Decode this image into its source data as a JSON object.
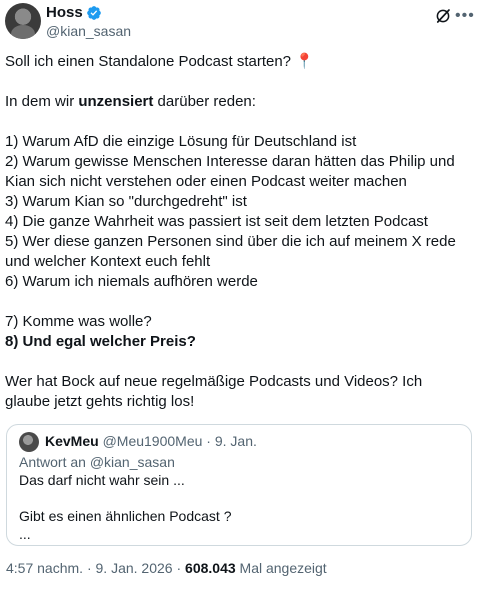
{
  "author": {
    "name": "Hoss",
    "handle": "@kian_sasan"
  },
  "tweet": {
    "line1": "Soll ich einen Standalone Podcast starten? 📍",
    "line2_pre": "In dem wir ",
    "line2_bold": "unzensiert",
    "line2_post": " darüber reden:",
    "items": [
      "1) Warum AfD die einzige Lösung für Deutschland ist",
      "2) Warum gewisse Menschen Interesse daran hätten das Philip und Kian sich nicht verstehen oder einen Podcast weiter machen",
      "3) Warum Kian so \"durchgedreht\" ist",
      "4) Die ganze Wahrheit was passiert ist seit dem letzten Podcast",
      "5) Wer diese ganzen Personen sind über die ich auf meinem X rede und welcher Kontext euch fehlt",
      "6) Warum ich niemals aufhören werde"
    ],
    "item7": "7) Komme was wolle?",
    "item8": "8) Und egal welcher Preis?",
    "closing": "Wer hat Bock auf neue regelmäßige Podcasts und Videos? Ich glaube jetzt gehts richtig los!"
  },
  "quote": {
    "name": "KevMeu",
    "handle": "@Meu1900Meu",
    "separator": "·",
    "date": "9. Jan.",
    "reply_to": "Antwort an @kian_sasan",
    "text1": "Das darf nicht wahr sein ...",
    "text2": "Gibt es einen ähnlichen Podcast ?",
    "text3": "..."
  },
  "footer": {
    "time": "4:57 nachm.",
    "separator": "·",
    "date": "9. Jan. 2026",
    "views": "608.043",
    "views_label": "Mal angezeigt"
  },
  "icons": {
    "verified": "verified-badge-icon",
    "grok": "grok-icon",
    "more": "more-icon"
  },
  "colors": {
    "verified": "#1d9bf0",
    "secondary_text": "#536471",
    "border": "#cfd9de"
  }
}
